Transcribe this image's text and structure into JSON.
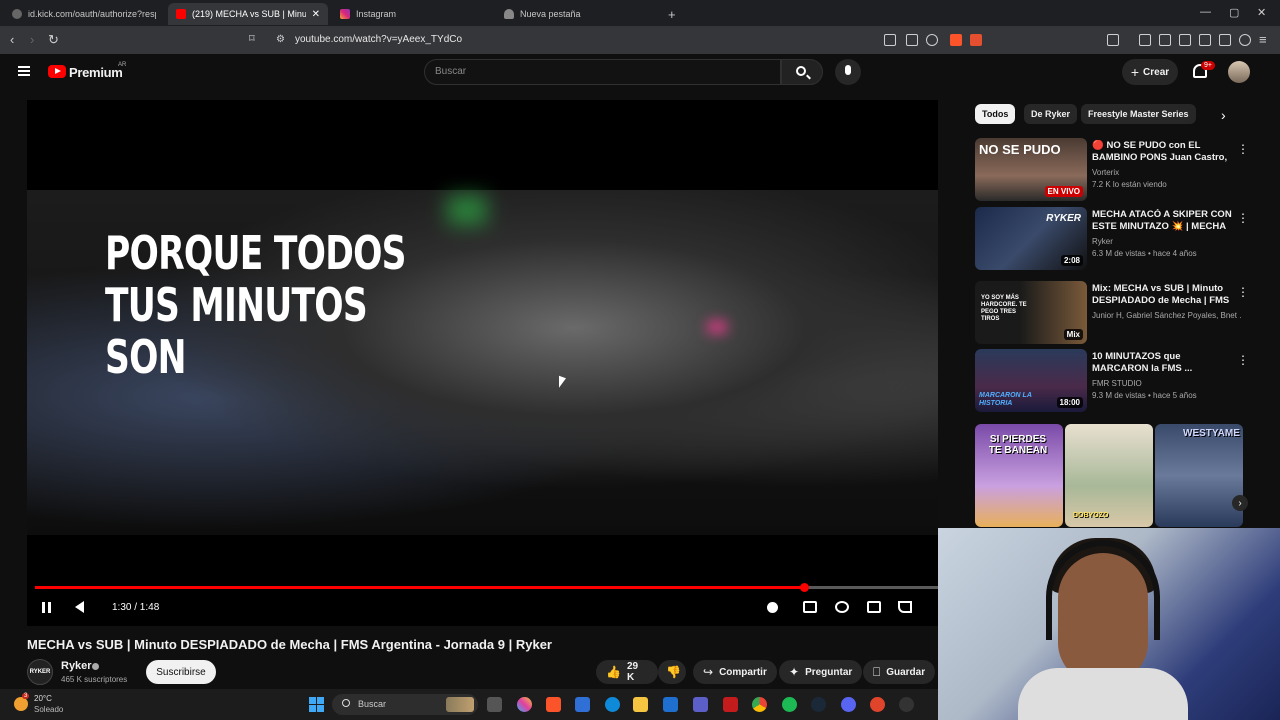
{
  "browser": {
    "tabs": [
      {
        "label": "id.kick.com/oauth/authorize?respons"
      },
      {
        "label": "(219) MECHA vs SUB | Minut"
      },
      {
        "label": "Instagram"
      },
      {
        "label": "Nueva pestaña"
      }
    ],
    "new_tab_label": "+",
    "url": "youtube.com/watch?v=yAeex_TYdCo"
  },
  "header": {
    "logo_text": "Premium",
    "country_code": "AR",
    "search_placeholder": "Buscar",
    "create_label": "Crear",
    "notifications_badge": "9+"
  },
  "player": {
    "caption_text": "PORQUE TODOS\nTUS MINUTOS\nSON",
    "time_display": "1:30 / 1:48",
    "progress_fraction": 0.852
  },
  "video": {
    "title": "MECHA vs SUB | Minuto DESPIADADO de Mecha | FMS Argentina - Jornada 9 | Ryker",
    "channel_name": "Ryker",
    "channel_avatar_text": "RYKER",
    "subscribers": "465 K suscriptores",
    "subscribe_label": "Suscribirse",
    "likes": "29 K",
    "share_label": "Compartir",
    "ask_label": "Preguntar",
    "save_label": "Guardar"
  },
  "sidebar": {
    "chips": [
      {
        "label": "Todos"
      },
      {
        "label": "De Ryker"
      },
      {
        "label": "Freestyle Master Series"
      }
    ],
    "recommendations": [
      {
        "title": "🔴 NO SE PUDO con EL BAMBINO PONS Juan Castro, ...",
        "channel": "Vorterix",
        "meta": "7.2 K lo están viendo",
        "badge": "EN VIVO",
        "thumb_text": "NO SE PUDO"
      },
      {
        "title": "MECHA ATACÓ A SKIPER CON ESTE MINUTAZO 💥 | MECHA ...",
        "channel": "Ryker",
        "meta": "6.3 M de vistas • hace 4 años",
        "badge": "2:08",
        "thumb_text": "RYKER"
      },
      {
        "title": "Mix: MECHA vs SUB | Minuto DESPIADADO de Mecha | FMS ...",
        "channel": "Junior H, Gabriel Sánchez Poyales, Bnet ...",
        "meta": "",
        "badge": "Mix",
        "thumb_text": "YO SOY MÁS HARDCORE. TE PEGO TRES TIROS"
      },
      {
        "title": "10 MINUTAZOS que MARCARON la FMS ...",
        "channel": "FMR STUDIO",
        "meta": "9.3 M de vistas • hace 5 años",
        "badge": "18:00",
        "thumb_text": "MARCARON LA HISTORIA"
      }
    ],
    "shorts": [
      {
        "text": "SI PIERDES TE BANEAN"
      },
      {
        "text": "DOBYOZO"
      },
      {
        "text": "WESTYAME"
      }
    ]
  },
  "taskbar": {
    "weather_temp": "20°C",
    "weather_desc": "Soleado",
    "weather_badge": "3",
    "search_placeholder": "Buscar"
  },
  "colors": {
    "brand_red": "#ff0000",
    "background": "#0f0f0f",
    "chip_bg": "#272727"
  }
}
